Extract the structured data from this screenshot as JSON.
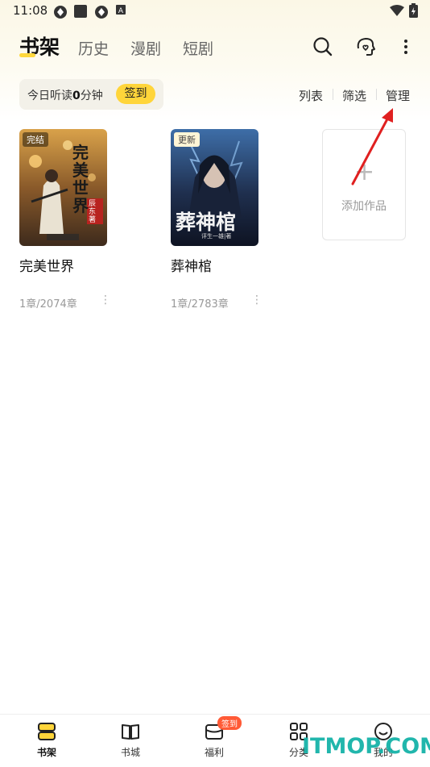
{
  "status": {
    "time": "11:08",
    "battery_icon": "battery-charging-icon",
    "wifi_icon": "wifi-icon"
  },
  "tabs": [
    {
      "label": "书架",
      "active": true
    },
    {
      "label": "历史",
      "active": false
    },
    {
      "label": "漫剧",
      "active": false
    },
    {
      "label": "短剧",
      "active": false
    }
  ],
  "listen": {
    "prefix": "今日听读",
    "minutes": "0",
    "suffix": "分钟",
    "signin": "签到"
  },
  "actions": {
    "list": "列表",
    "filter": "筛选",
    "manage": "管理"
  },
  "books": [
    {
      "title": "完美世界",
      "badge": "完结",
      "progress": "1章/2074章",
      "cover_title": "完美世界",
      "cover_author": "辰东著",
      "more": "⋮"
    },
    {
      "title": "葬神棺",
      "badge": "更新",
      "progress": "1章/2783章",
      "cover_title": "葬神棺",
      "cover_author": "评生一雄|著",
      "more": "⋮"
    }
  ],
  "add_card": {
    "plus": "+",
    "label": "添加作品"
  },
  "bottom_nav": [
    {
      "label": "书架",
      "active": true
    },
    {
      "label": "书城",
      "active": false
    },
    {
      "label": "福利",
      "active": false,
      "badge": "签到"
    },
    {
      "label": "分类",
      "active": false
    },
    {
      "label": "我的",
      "active": false
    }
  ],
  "watermark": "ITMOP.COM",
  "colors": {
    "accent": "#ffd53a",
    "badge": "#ff5a36",
    "watermark": "#16b3a8",
    "arrow": "#e02020"
  }
}
